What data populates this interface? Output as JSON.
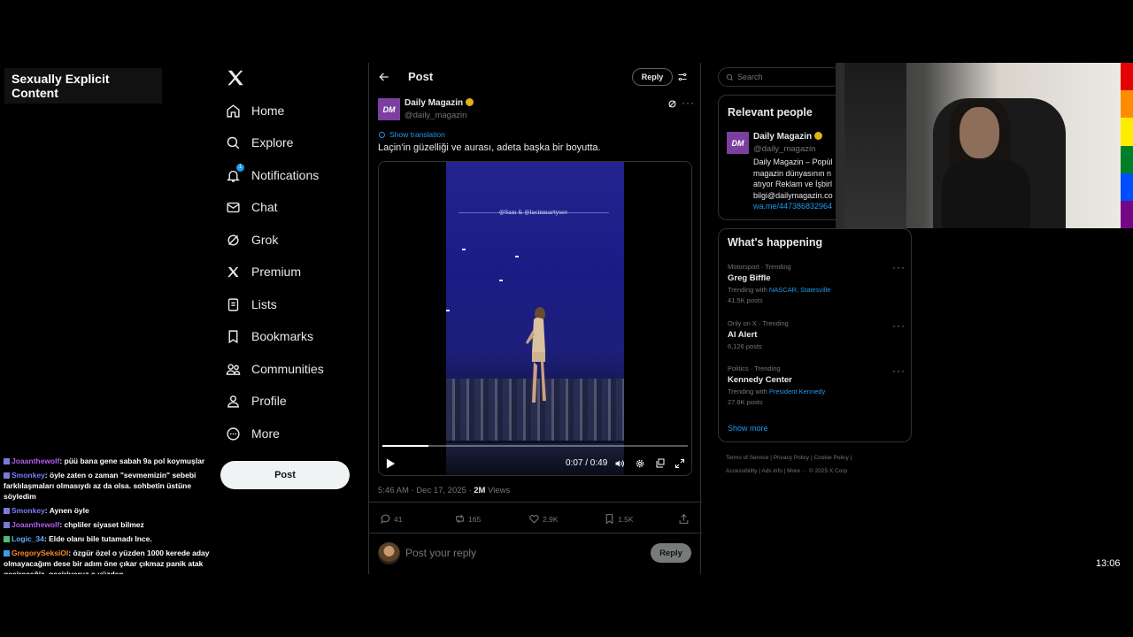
{
  "overlay": {
    "content_warning": "Sexually Explicit Content",
    "clock": "13:06"
  },
  "chat": [
    {
      "user": "Joaanthewolf",
      "user_color": "#b65cf0",
      "text": "püü bana gene sabah 9a pol koymuşlar"
    },
    {
      "user": "Smonkey",
      "user_color": "#7b7bff",
      "text": "öyle zaten o zaman \"sevmemizin\" sebebi farklılaşmaları olmasıydı az da olsa. sohbetin üstüne söyledim"
    },
    {
      "user": "Smonkey",
      "user_color": "#7b7bff",
      "text": "Aynen öyle"
    },
    {
      "user": "Joaanthewolf",
      "user_color": "#b65cf0",
      "text": "chpliler siyaset bilmez"
    },
    {
      "user": "Logic_34",
      "user_color": "#5db2ff",
      "text": "Elde olanı bile tutamadı Ince."
    },
    {
      "user": "GregorySeksiOl",
      "user_color": "#ff8a2a",
      "text": "özgür özel o yüzden 1000 kerede aday olmayacağım dese bir adım öne çıkar çıkmaz panik atak geçireceğiz, geçiriyoruz o yüzden"
    }
  ],
  "nav": {
    "items": [
      {
        "label": "Home",
        "icon": "home-icon"
      },
      {
        "label": "Explore",
        "icon": "search-icon"
      },
      {
        "label": "Notifications",
        "icon": "bell-icon",
        "badge": "1"
      },
      {
        "label": "Chat",
        "icon": "mail-icon"
      },
      {
        "label": "Grok",
        "icon": "grok-icon"
      },
      {
        "label": "Premium",
        "icon": "x-icon"
      },
      {
        "label": "Lists",
        "icon": "list-icon"
      },
      {
        "label": "Bookmarks",
        "icon": "bookmark-icon"
      },
      {
        "label": "Communities",
        "icon": "communities-icon"
      },
      {
        "label": "Profile",
        "icon": "profile-icon"
      },
      {
        "label": "More",
        "icon": "more-circle-icon"
      }
    ],
    "post_button": "Post"
  },
  "main": {
    "title": "Post",
    "reply_button": "Reply",
    "author": {
      "name": "Daily Magazin",
      "handle": "@daily_magazin",
      "avatar_text": "DM"
    },
    "show_translation": "Show translation",
    "text": "Laçin'in güzelliği ve aurası, adeta başka bir boyutta.",
    "video": {
      "caption": "@Sam & @lacinmartysev",
      "time": "0:07 / 0:49",
      "progress": 0.15
    },
    "timestamp": "5:46 AM · Dec 17, 2025 · ",
    "views_count": "2M",
    "views_label": " Views",
    "actions": {
      "replies": "41",
      "reposts": "165",
      "likes": "2.9K",
      "bookmarks": "1.5K"
    },
    "reply_placeholder": "Post your reply",
    "reply_submit": "Reply"
  },
  "sidebar": {
    "search_placeholder": "Search",
    "relevant_title": "Relevant people",
    "relevant": {
      "name": "Daily Magazin",
      "handle": "@daily_magazin",
      "avatar_text": "DM",
      "bio_lines": [
        "Daily Magazin – Popül",
        "magazin dünyasının n",
        "atıyor Reklam ve İşbirl",
        "bilgi@dailymagazin.co"
      ],
      "link": "wa.me/447386832964"
    },
    "happening_title": "What's happening",
    "trends": [
      {
        "meta": "Motorsport · Trending",
        "name": "Greg Biffle",
        "with_label": "Trending with ",
        "with": "NASCAR, Statesville",
        "count": "41.5K posts"
      },
      {
        "meta": "Only on X · Trending",
        "name": "AI Alert",
        "with_label": "",
        "with": "",
        "count": "6,126 posts"
      },
      {
        "meta": "Politics · Trending",
        "name": "Kennedy Center",
        "with_label": "Trending with ",
        "with": "President Kennedy",
        "count": "27.6K posts"
      }
    ],
    "show_more": "Show more",
    "footer_line1": "Terms of Service  |  Privacy Policy  |  Cookie Policy  |",
    "footer_line2": "Accessibility  |  Ads info  |  More ···  © 2025 X Corp."
  },
  "colors": {
    "accent": "#1d9bf0",
    "background": "#000000",
    "border": "#2f3336",
    "muted": "#71767b",
    "verified": "#e0b316"
  }
}
